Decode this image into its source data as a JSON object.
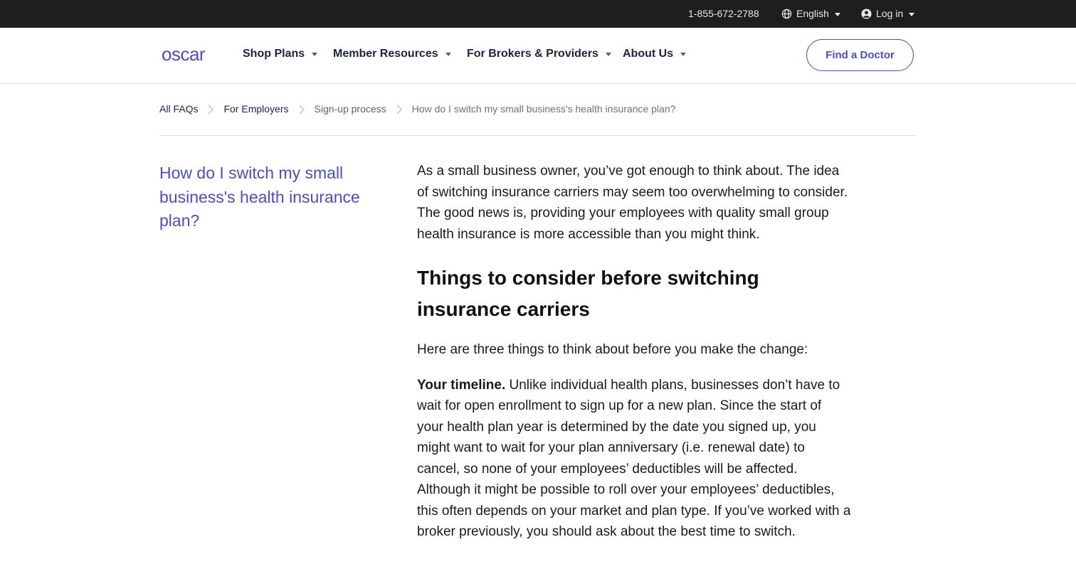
{
  "utility": {
    "phone": "1-855-672-2788",
    "language": "English",
    "login": "Log in"
  },
  "header": {
    "logo_text": "oscar",
    "nav": [
      {
        "label": "Shop Plans"
      },
      {
        "label": "Member Resources"
      },
      {
        "label": "For Brokers & Providers"
      },
      {
        "label": "About Us"
      }
    ],
    "cta_label": "Find a Doctor"
  },
  "breadcrumb": [
    {
      "label": "All FAQs"
    },
    {
      "label": "For Employers"
    },
    {
      "label": "Sign-up process"
    },
    {
      "label": "How do I switch my small business's health insurance plan?"
    }
  ],
  "aside": {
    "title": "How do I switch my small business's health insurance plan?"
  },
  "article": {
    "intro": "As a small business owner, you’ve got enough to think about. The idea of switching insurance carriers may seem too overwhelming to consider. The good news is, providing your employees with quality small group health insurance is more accessible than you might think.",
    "heading": "Things to consider before switching insurance carriers",
    "lead": "Here are three things to think about before you make the change:",
    "timeline_label": "Your timeline.",
    "timeline_text": " Unlike individual health plans, businesses don’t have to wait for open enrollment to sign up for a new plan. Since the start of your health plan year is determined by the date you signed up, you might want to wait for your plan anniversary (i.e. renewal date) to cancel, so none of your employees’ deductibles will be affected. Although it might be possible to roll over your employees’ deductibles, this often depends on your market and plan type. If you’ve worked with a broker previously, you should ask about the best time to switch."
  },
  "colors": {
    "brand": "#4b4bd0",
    "utility_bg": "#1e1e1e",
    "nav_text": "#1c2340"
  }
}
